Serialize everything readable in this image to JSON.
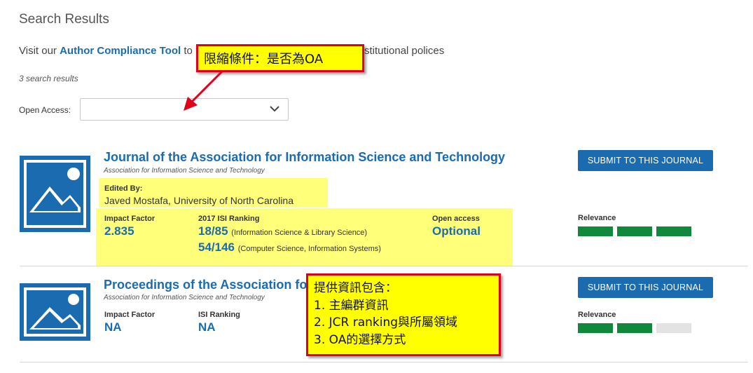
{
  "page": {
    "title": "Search Results"
  },
  "compliance": {
    "prefix": "Visit our ",
    "link": "Author Compliance Tool",
    "middle": " to",
    "suffix": "stitutional polices"
  },
  "results_count": "3 search results",
  "filter": {
    "label": "Open Access:",
    "value": ""
  },
  "annotations": {
    "filter_note": "限縮條件：是否為OA",
    "info_note": {
      "heading": "提供資訊包含：",
      "items": [
        "1. 主編群資訊",
        "2. JCR ranking與所屬領域",
        "3. OA的選擇方式"
      ]
    },
    "box_border_color": "#e0001b",
    "box_fill_color": "#ffff00"
  },
  "results": [
    {
      "title": "Journal of the Association for Information Science and Technology",
      "publisher": "Association for Information Science and Technology",
      "edited_by_label": "Edited By:",
      "editor": "Javed Mostafa, University of North Carolina",
      "impact_factor_label": "Impact Factor",
      "impact_factor": "2.835",
      "ranking_label": "2017 ISI Ranking",
      "rankings": [
        {
          "value": "18/85",
          "category": "(Information Science & Library Science)"
        },
        {
          "value": "54/146",
          "category": "(Computer Science, Information Systems)"
        }
      ],
      "open_access_label": "Open access",
      "open_access": "Optional",
      "submit_label": "SUBMIT TO THIS JOURNAL",
      "relevance_label": "Relevance",
      "relevance": 3
    },
    {
      "title": "Proceedings of the Association for In",
      "publisher": "Association for Information Science and Technology",
      "impact_factor_label": "Impact Factor",
      "impact_factor": "NA",
      "ranking_label": "ISI Ranking",
      "ranking": "NA",
      "submit_label": "SUBMIT TO THIS JOURNAL",
      "relevance_label": "Relevance",
      "relevance": 2
    }
  ],
  "colors": {
    "link": "#1a6bb0",
    "relevance_on": "#11893d",
    "relevance_off": "#e3e3e3",
    "highlight": "#ffff7a"
  }
}
